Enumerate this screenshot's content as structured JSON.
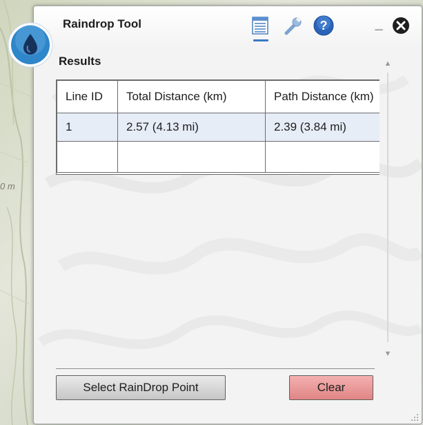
{
  "window": {
    "title": "Raindrop Tool"
  },
  "map": {
    "scale_label": "0 m"
  },
  "toolbar": {
    "results_icon": "table-icon",
    "settings_icon": "wrench-icon",
    "help_icon": "help-icon",
    "minimize_label": "_",
    "close_icon": "close-icon"
  },
  "results": {
    "heading": "Results",
    "columns": [
      "Line ID",
      "Total Distance (km)",
      "Path Distance (km)"
    ],
    "rows": [
      {
        "line_id": "1",
        "total_distance": "2.57 (4.13 mi)",
        "path_distance": "2.39 (3.84 mi)"
      }
    ]
  },
  "scrollbar": {
    "up_arrow": "▲",
    "down_arrow": "▼"
  },
  "buttons": {
    "select_label": "Select RainDrop Point",
    "clear_label": "Clear"
  },
  "colors": {
    "accent": "#3a78c4",
    "badge": "#2f86c9",
    "clear_button": "#e89292",
    "row_highlight": "#e7edf7"
  }
}
